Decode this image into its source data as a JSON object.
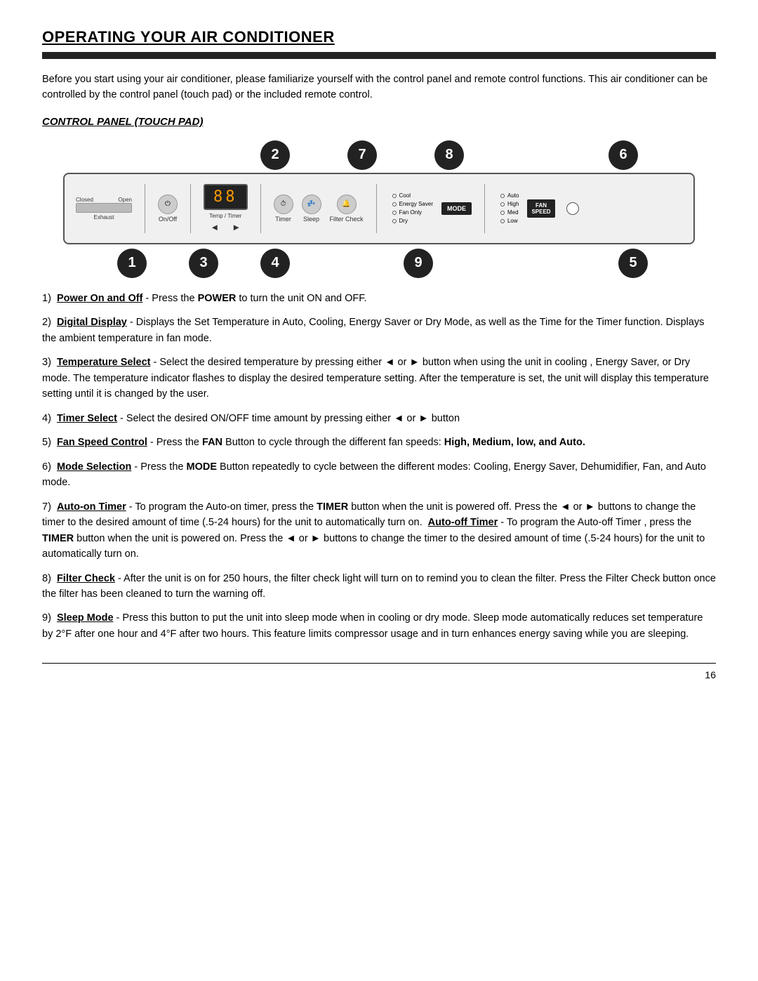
{
  "page": {
    "title": "OPERATING YOUR AIR CONDITIONER",
    "title_bar": "",
    "intro": "Before you start using your air conditioner, please familiarize yourself with the control panel and remote control functions. This air conditioner can be controlled by the control panel (touch pad) or the included remote control.",
    "section_title": "CONTROL PANEL (TOUCH PAD)",
    "panel": {
      "vent_label_left": "Closed",
      "vent_label_right": "Open",
      "exhaust_label": "Exhaust",
      "on_off_label": "On/Off",
      "temp_timer_label": "Temp / Timer",
      "timer_label": "Timer",
      "sleep_label": "Sleep",
      "filter_check_label": "Filter Check",
      "mode_label": "MODE",
      "fan_speed_label": "FAN SPEED",
      "display_value": "88",
      "modes": [
        "Cool",
        "Energy Saver",
        "Fan Only",
        "Dry"
      ],
      "fan_speeds": [
        "Auto",
        "High",
        "Med",
        "Low"
      ]
    },
    "badges_top": [
      {
        "num": "2",
        "position": "left"
      },
      {
        "num": "7",
        "position": "center-left"
      },
      {
        "num": "8",
        "position": "center-right"
      },
      {
        "num": "6",
        "position": "right"
      }
    ],
    "badges_bottom": [
      {
        "num": "1"
      },
      {
        "num": "3"
      },
      {
        "num": "4"
      },
      {
        "num": "9"
      },
      {
        "num": "5"
      }
    ],
    "instructions": [
      {
        "num": "1",
        "label": "Power On and Off",
        "label_bold": true,
        "label_underline": true,
        "text": " - Press the ",
        "keyword": "POWER",
        "text2": " to turn the unit ON and OFF."
      },
      {
        "num": "2",
        "label": "Digital Display",
        "label_bold": true,
        "label_underline": true,
        "text": " - Displays the Set Temperature in Auto, Cooling, Energy Saver or Dry Mode, as well as the Time for the Timer function. Displays the ambient temperature in fan mode."
      },
      {
        "num": "3",
        "label": "Temperature Select",
        "label_bold": true,
        "label_underline": true,
        "text": " - Select the desired temperature by pressing either ◄ or ► button when using the unit in cooling , Energy Saver, or Dry mode. The temperature indicator flashes to display the desired temperature setting. After the temperature is set, the unit will display this temperature setting until it is changed by the user."
      },
      {
        "num": "4",
        "label": "Timer Select",
        "label_bold": true,
        "label_underline": true,
        "text": " -  Select the desired ON/OFF time amount by pressing either ◄ or ► button"
      },
      {
        "num": "5",
        "label": "Fan Speed Control",
        "label_bold": true,
        "label_underline": true,
        "text": " - Press the ",
        "keyword": "FAN",
        "text2": " Button to cycle through the different fan speeds: ",
        "bold_end": "High, Medium, low, and Auto."
      },
      {
        "num": "6",
        "label": "Mode Selection",
        "label_bold": true,
        "label_underline": true,
        "text": " - Press the ",
        "keyword": "MODE",
        "text2": " Button repeatedly to cycle between the different modes: Cooling, Energy Saver, Dehumidifier, Fan, and Auto mode."
      },
      {
        "num": "7",
        "label": "Auto-on Timer",
        "label_bold": true,
        "label_underline": true,
        "text": " - To program the Auto-on timer, press the ",
        "keyword": "TIMER",
        "text2": " button when the unit is powered off. Press the ◄ or ► buttons to change the timer to the desired amount of time (.5-24 hours) for the unit to automatically turn on. ",
        "label2": "Auto-off Timer",
        "label2_bold": true,
        "label2_underline": true,
        "text3": " - To program the Auto-off Timer , press the ",
        "keyword2": "TIMER",
        "text4": " button when the unit is powered on.  Press the ◄ or ► buttons to change the timer to the desired amount of time (.5-24 hours) for the unit to automatically turn on."
      },
      {
        "num": "8",
        "label": "Filter Check",
        "label_bold": true,
        "label_underline": true,
        "text": " - After the unit is on for 250 hours, the filter check light will turn on to remind you to clean the filter. Press the Filter Check button once the filter has been cleaned to turn the warning off."
      },
      {
        "num": "9",
        "label": "Sleep Mode",
        "label_bold": true,
        "label_underline": true,
        "text": " -  Press this button to put the unit into sleep mode when in cooling or dry mode. Sleep mode automatically reduces set temperature by 2°F after one hour and 4°F after two hours. This feature limits compressor usage and in turn enhances energy saving while you are sleeping."
      }
    ],
    "footer": {
      "page_number": "16"
    }
  }
}
